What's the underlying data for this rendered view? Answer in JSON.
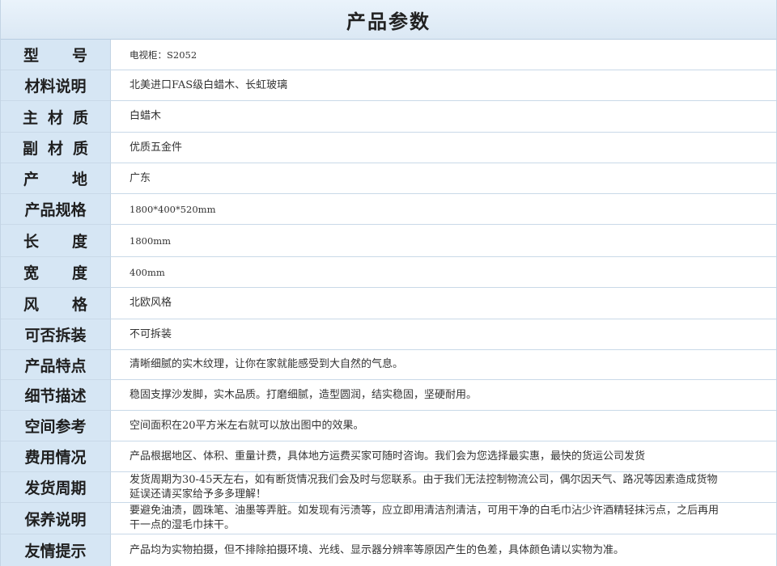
{
  "page_title": "产品参数",
  "rows": [
    {
      "label": "型号",
      "value": "电视柜：S2052"
    },
    {
      "label": "材料说明",
      "value": "北美进口FAS级白蜡木、长虹玻璃"
    },
    {
      "label": "主材质",
      "value": "白蜡木"
    },
    {
      "label": "副材质",
      "value": "优质五金件"
    },
    {
      "label": "产地",
      "value": "广东"
    },
    {
      "label": "产品规格",
      "value": "1800*400*520mm"
    },
    {
      "label": "长度",
      "value": "1800mm"
    },
    {
      "label": "宽度",
      "value": "400mm"
    },
    {
      "label": "风格",
      "value": "北欧风格"
    },
    {
      "label": "可否拆装",
      "value": "不可拆装"
    },
    {
      "label": "产品特点",
      "value": "清晰细腻的实木纹理，让你在家就能感受到大自然的气息。"
    },
    {
      "label": "细节描述",
      "value": "稳固支撑沙发脚，实木品质。打磨细腻，造型圆润，结实稳固，坚硬耐用。"
    },
    {
      "label": "空间参考",
      "value": "空间面积在20平方米左右就可以放出图中的效果。"
    },
    {
      "label": "费用情况",
      "value": "产品根据地区、体积、重量计费，具体地方运费买家可随时咨询。我们会为您选择最实惠，最快的货运公司发货"
    },
    {
      "label": "发货周期",
      "value": "发货周期为30-45天左右，如有断货情况我们会及时与您联系。由于我们无法控制物流公司，偶尔因天气、路况等因素造成货物延误还请买家给予多多理解！"
    },
    {
      "label": "保养说明",
      "value": "要避免油渍，圆珠笔、油墨等弄脏。如发现有污渍等，应立即用清洁剂清洁，可用干净的白毛巾沾少许酒精轻抹污点，之后再用干一点的湿毛巾抹干。"
    },
    {
      "label": "友情提示",
      "value": "产品均为实物拍摄，但不排除拍摄环境、光线、显示器分辨率等原因产生的色差，具体颜色请以实物为准。"
    }
  ]
}
